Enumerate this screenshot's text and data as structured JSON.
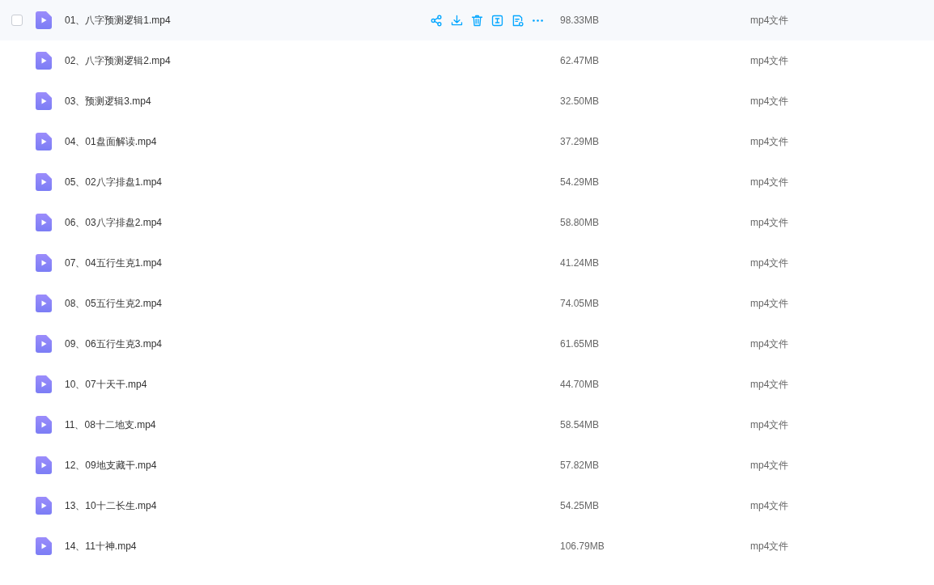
{
  "files": [
    {
      "name": "01、八字预测逻辑1.mp4",
      "size": "98.33MB",
      "type": "mp4文件",
      "hovered": true,
      "checked": false
    },
    {
      "name": "02、八字预测逻辑2.mp4",
      "size": "62.47MB",
      "type": "mp4文件",
      "hovered": false,
      "checked": false
    },
    {
      "name": "03、预测逻辑3.mp4",
      "size": "32.50MB",
      "type": "mp4文件",
      "hovered": false,
      "checked": false
    },
    {
      "name": "04、01盘面解读.mp4",
      "size": "37.29MB",
      "type": "mp4文件",
      "hovered": false,
      "checked": false
    },
    {
      "name": "05、02八字排盘1.mp4",
      "size": "54.29MB",
      "type": "mp4文件",
      "hovered": false,
      "checked": false
    },
    {
      "name": "06、03八字排盘2.mp4",
      "size": "58.80MB",
      "type": "mp4文件",
      "hovered": false,
      "checked": false
    },
    {
      "name": "07、04五行生克1.mp4",
      "size": "41.24MB",
      "type": "mp4文件",
      "hovered": false,
      "checked": false
    },
    {
      "name": "08、05五行生克2.mp4",
      "size": "74.05MB",
      "type": "mp4文件",
      "hovered": false,
      "checked": false
    },
    {
      "name": "09、06五行生克3.mp4",
      "size": "61.65MB",
      "type": "mp4文件",
      "hovered": false,
      "checked": false
    },
    {
      "name": "10、07十天干.mp4",
      "size": "44.70MB",
      "type": "mp4文件",
      "hovered": false,
      "checked": false
    },
    {
      "name": "11、08十二地支.mp4",
      "size": "58.54MB",
      "type": "mp4文件",
      "hovered": false,
      "checked": false
    },
    {
      "name": "12、09地支藏干.mp4",
      "size": "57.82MB",
      "type": "mp4文件",
      "hovered": false,
      "checked": false
    },
    {
      "name": "13、10十二长生.mp4",
      "size": "54.25MB",
      "type": "mp4文件",
      "hovered": false,
      "checked": false
    },
    {
      "name": "14、11十神.mp4",
      "size": "106.79MB",
      "type": "mp4文件",
      "hovered": false,
      "checked": false
    }
  ]
}
